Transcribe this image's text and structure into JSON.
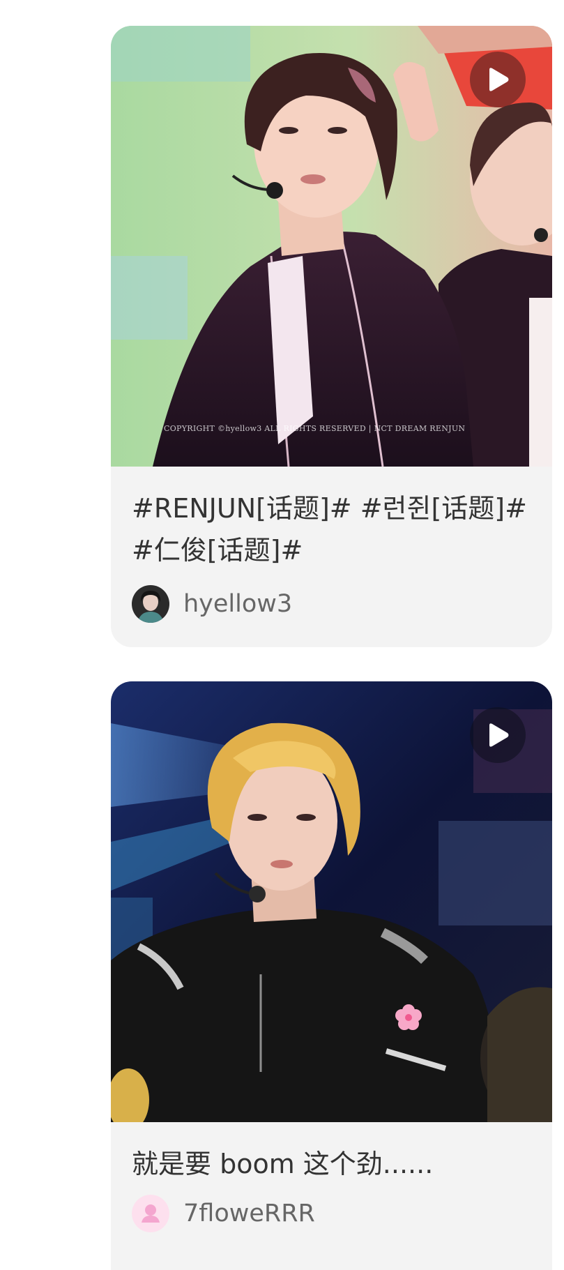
{
  "feed": {
    "cards": [
      {
        "title": "#RENJUN[话题]# #런쥔[话题]# #仁俊[话题]#",
        "author": "hyellow3",
        "media_type": "video",
        "play_icon": "play-icon",
        "watermark": "COPYRIGHT ©hyellow3 ALL RIGHTS RESERVED | NCT DREAM RENJUN"
      },
      {
        "title": "就是要 boom 这个劲......",
        "author": "7floweRRR",
        "media_type": "video",
        "play_icon": "play-icon",
        "avatar_icon": "default-user-icon"
      }
    ]
  },
  "colors": {
    "card_background": "#f3f3f3",
    "title_text": "#333333",
    "author_text": "#666666",
    "default_avatar_bg": "#fde0ee",
    "default_avatar_fg": "#f4a6cf"
  }
}
